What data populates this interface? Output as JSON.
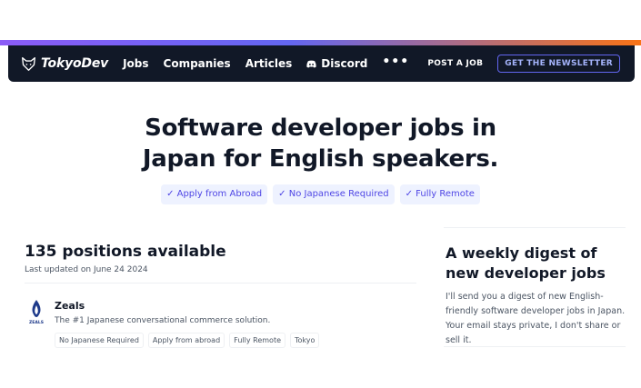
{
  "nav": {
    "brand": "TokyoDev",
    "links": [
      {
        "label": "Jobs"
      },
      {
        "label": "Companies"
      },
      {
        "label": "Articles"
      },
      {
        "label": "Discord"
      }
    ],
    "more": "•••",
    "post_job": "POST A JOB",
    "newsletter": "GET THE NEWSLETTER"
  },
  "hero": {
    "title_line1": "Software developer jobs in",
    "title_line2": "Japan for English speakers.",
    "chips": [
      "✓ Apply from Abroad",
      "✓ No Japanese Required",
      "✓ Fully Remote"
    ]
  },
  "listing": {
    "count_title": "135 positions available",
    "updated": "Last updated on June 24 2024",
    "jobs": [
      {
        "company": "Zeals",
        "logo_text": "ZEALS",
        "description": "The #1 Japanese conversational commerce solution.",
        "tags": [
          "No Japanese Required",
          "Apply from abroad",
          "Fully Remote",
          "Tokyo"
        ]
      }
    ]
  },
  "digest": {
    "title": "A weekly digest of new developer jobs",
    "body": "I'll send you a digest of new English-friendly software developer jobs in Japan. Your email stays private, I don't share or sell it."
  },
  "colors": {
    "nav_bg": "#111827",
    "accent": "#6366f1",
    "chip_bg": "#eef2ff",
    "chip_text": "#4f46e5"
  }
}
